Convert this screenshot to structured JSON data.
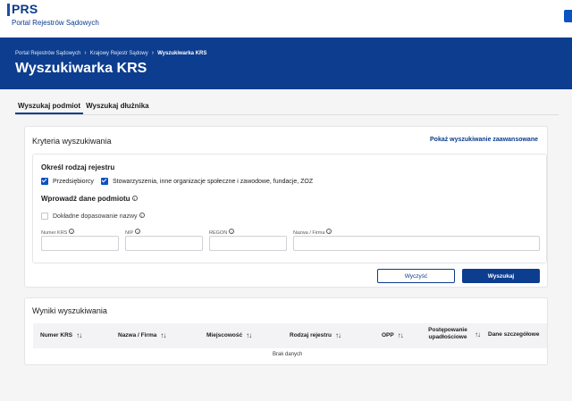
{
  "header": {
    "logo_text": "PRS",
    "logo_subtitle": "Portal Rejestrów Sądowych"
  },
  "breadcrumb": {
    "items": [
      "Portal Rejestrów Sądowych",
      "Krajowy Rejestr Sądowy",
      "Wyszukiwarka KRS"
    ]
  },
  "page": {
    "title": "Wyszukiwarka KRS"
  },
  "tabs": [
    {
      "label": "Wyszukaj podmiot",
      "active": true
    },
    {
      "label": "Wyszukaj dłużnika",
      "active": false
    }
  ],
  "criteria": {
    "title": "Kryteria wyszukiwania",
    "advanced_link": "Pokaż wyszukiwanie zaawansowane",
    "register_heading": "Określ rodzaj rejestru",
    "register_options": [
      {
        "label": "Przedsiębiorcy",
        "checked": true
      },
      {
        "label": "Stowarzyszenia, inne organizacje społeczne i zawodowe, fundacje, ZOZ",
        "checked": true
      }
    ],
    "entity_heading": "Wprowadź dane podmiotu",
    "exact_match_label": "Dokładne dopasowanie nazwy",
    "exact_match_checked": false,
    "fields": [
      {
        "label": "Numer KRS",
        "value": ""
      },
      {
        "label": "NIP",
        "value": ""
      },
      {
        "label": "REGON",
        "value": ""
      },
      {
        "label": "Nazwa / Firma",
        "value": ""
      }
    ],
    "clear_button": "Wyczyść",
    "search_button": "Wyszukaj"
  },
  "results": {
    "title": "Wyniki wyszukiwania",
    "columns": [
      "Numer KRS",
      "Nazwa / Firma",
      "Miejscowość",
      "Rodzaj rejestru",
      "OPP",
      "Postępowanie upadłościowe",
      "Dane szczegółowe"
    ],
    "empty_text": "Brak danych"
  },
  "colors": {
    "brand": "#0d3d8f",
    "accent": "#0b53c1"
  }
}
